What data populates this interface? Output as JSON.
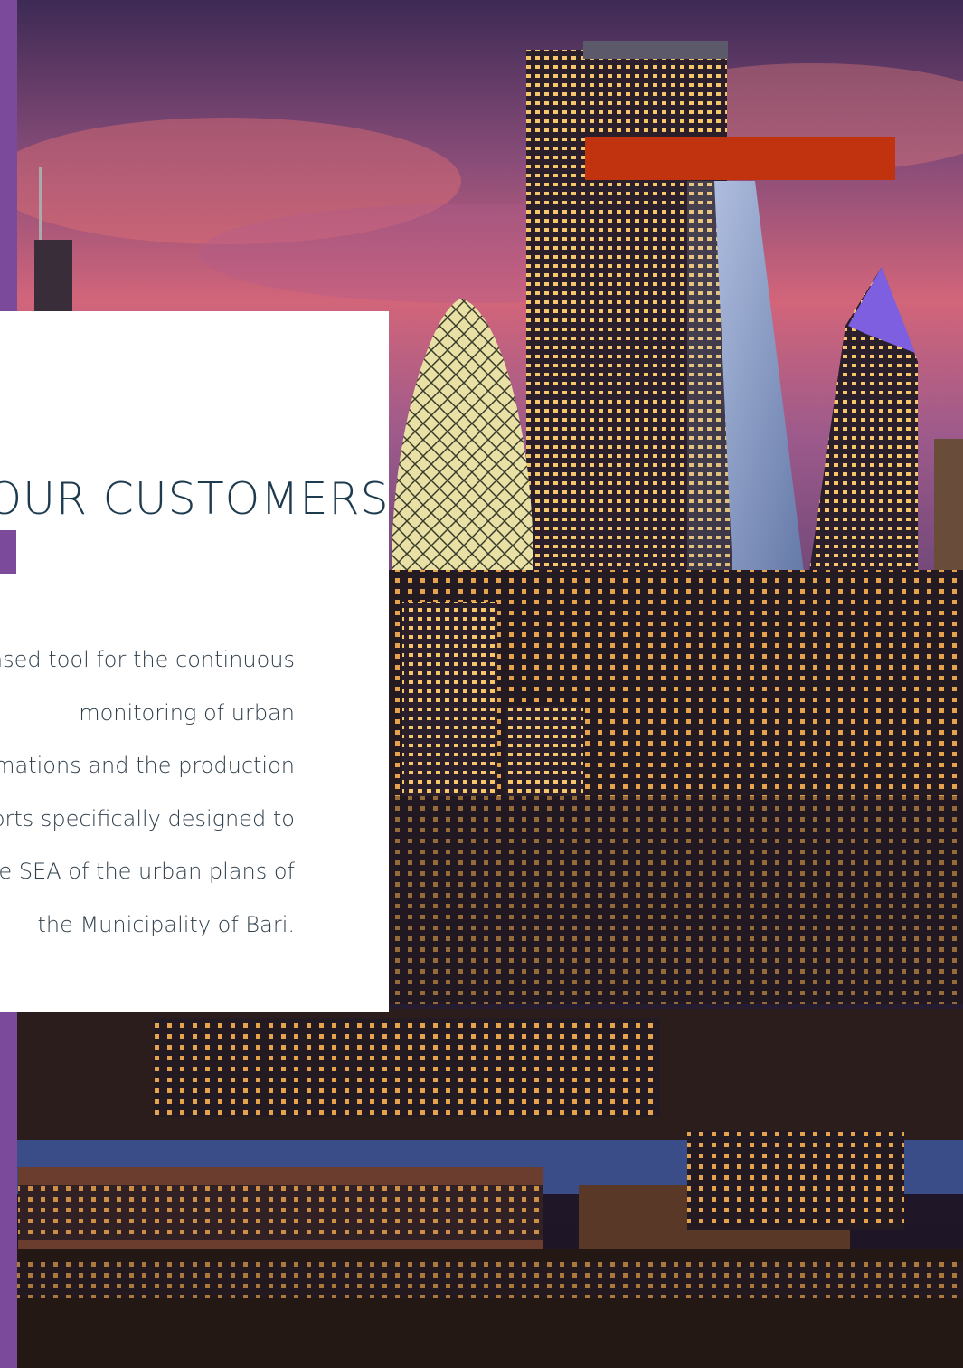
{
  "testimonials": {
    "heading": "WHAT OUR CUSTOMERS SAY",
    "body_lines": [
      "A web-based tool for the continuous",
      "monitoring of urban",
      "transformations and the production",
      "of reports specifically designed to",
      "support the SEA of the urban plans of",
      "the Municipality of Bari."
    ]
  },
  "background": {
    "image": "night-city-skyline-photo"
  },
  "colors": {
    "accent_purple": "#7c4a9a",
    "accent_red": "#c1330f",
    "heading_text": "#1d3a4e",
    "card_background": "#ffffff"
  }
}
